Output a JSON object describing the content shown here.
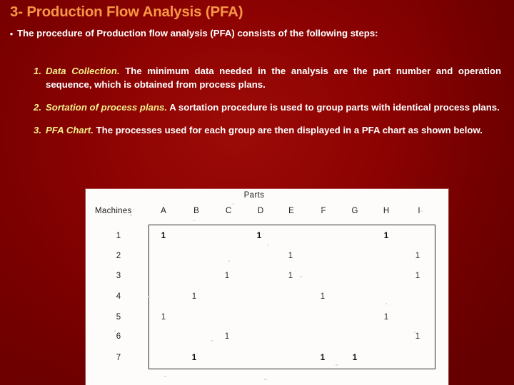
{
  "slide": {
    "title": "3- Production Flow Analysis (PFA)",
    "bullet_marker": "•",
    "bullet_text": "The procedure of Production flow analysis (PFA) consists of the following steps:",
    "steps": [
      {
        "number": "1.",
        "lead": "Data Collection.",
        "text": " The minimum data needed in the analysis are the part number and operation sequence, which is obtained from process plans."
      },
      {
        "number": "2.",
        "lead": "Sortation of process plans.",
        "text": " A sortation procedure is used to group parts with identical process plans."
      },
      {
        "number": "3.",
        "lead": "PFA Chart.",
        "text": " The processes used for each group are then displayed in a PFA chart as shown below."
      }
    ],
    "colors": {
      "background": "#8b0000",
      "title": "#f79646",
      "body_text": "#ffffff",
      "lead_text": "#f2f08a",
      "panel_background": "#fdfcfa",
      "grid_border": "#2b2b2b"
    }
  },
  "chart_data": {
    "type": "table",
    "title": "Parts",
    "row_axis_label": "Machines",
    "categories": [
      "A",
      "B",
      "C",
      "D",
      "E",
      "F",
      "G",
      "H",
      "I"
    ],
    "rows": [
      "1",
      "2",
      "3",
      "4",
      "5",
      "6",
      "7"
    ],
    "mark_symbol": "1",
    "matrix": [
      [
        1,
        0,
        0,
        1,
        0,
        0,
        0,
        1,
        0
      ],
      [
        0,
        0,
        0,
        0,
        1,
        0,
        0,
        0,
        1
      ],
      [
        0,
        0,
        1,
        0,
        1,
        0,
        0,
        0,
        1
      ],
      [
        0,
        1,
        0,
        0,
        0,
        1,
        0,
        0,
        0
      ],
      [
        1,
        0,
        0,
        0,
        0,
        0,
        0,
        1,
        0
      ],
      [
        0,
        0,
        1,
        0,
        0,
        0,
        0,
        0,
        1
      ],
      [
        0,
        1,
        0,
        0,
        0,
        1,
        1,
        0,
        0
      ]
    ],
    "xlabel": "Parts",
    "ylabel": "Machines",
    "grid": true,
    "legend": ""
  }
}
